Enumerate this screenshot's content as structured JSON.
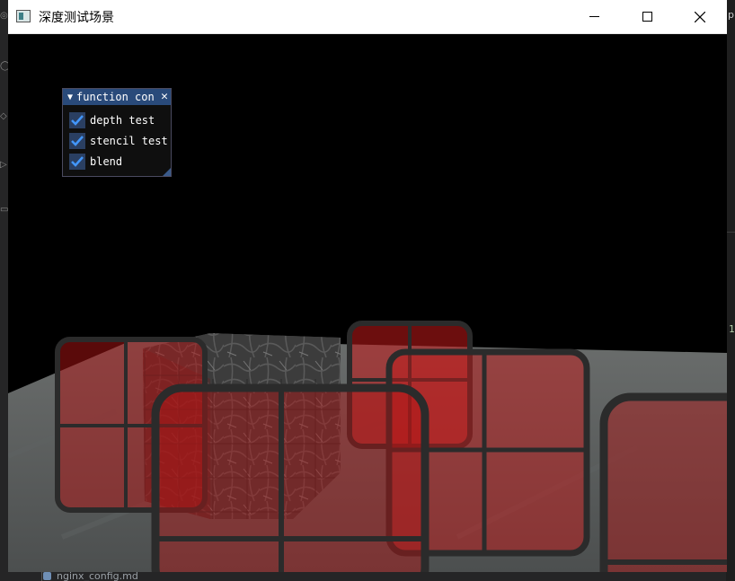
{
  "window": {
    "title": "深度测试场景"
  },
  "panel": {
    "title": "function con",
    "items": [
      {
        "label": "depth test",
        "checked": true
      },
      {
        "label": "stencil test",
        "checked": true
      },
      {
        "label": "blend",
        "checked": true
      }
    ]
  },
  "background": {
    "editor_tab": "nginx_config.md",
    "right_text": "p",
    "right_number": "1"
  },
  "colors": {
    "glass_red": "#b41414",
    "frame": "#2b2b2b",
    "floor": "#5a5e5e",
    "panel_title": "#294a7a",
    "checkbox": "#2a3f62",
    "checkmark": "#4296fa"
  }
}
